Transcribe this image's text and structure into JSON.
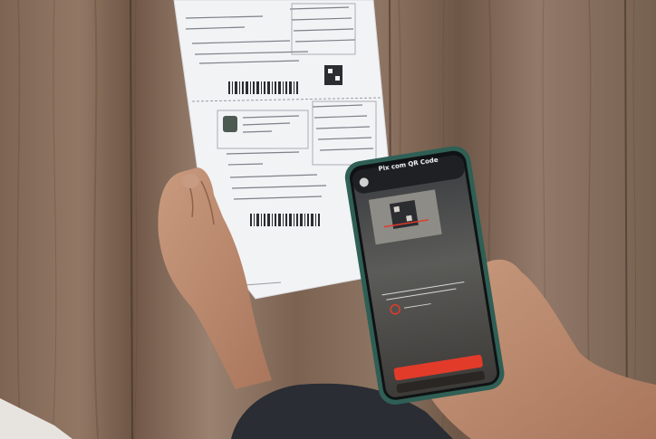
{
  "phone": {
    "screen_title": "Pix com QR Code",
    "primary_button_label": "",
    "secondary_button_label": ""
  },
  "colors": {
    "wall_wood": "#8a6e5a",
    "paper": "#f3f4f6",
    "phone_frame": "#2f5f55",
    "accent_red": "#e23b2a",
    "sleeve": "#2a2d33"
  }
}
